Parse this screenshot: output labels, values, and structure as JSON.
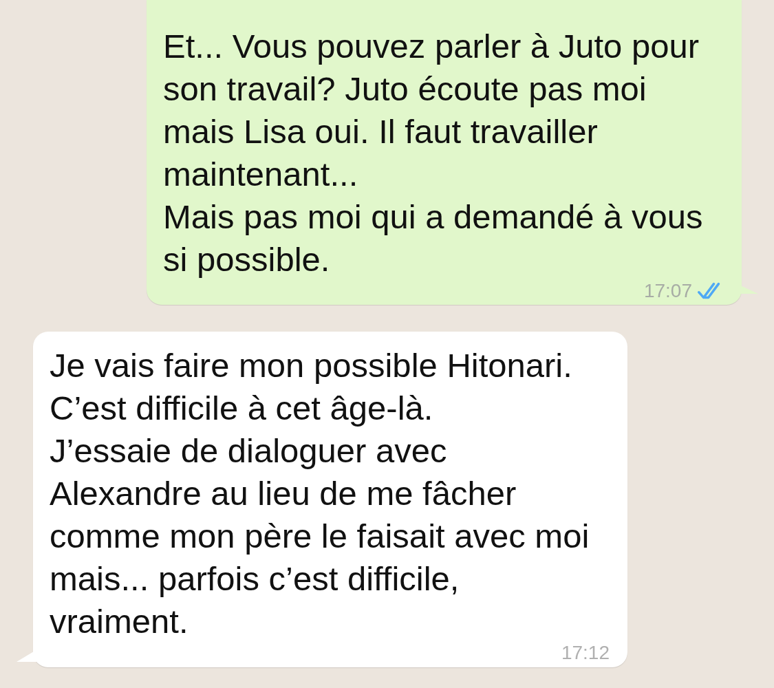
{
  "messages": [
    {
      "kind": "outgoing",
      "text": "Et... Vous pouvez parler à Juto pour\nson travail? Juto écoute pas moi\nmais Lisa oui. Il faut travailler\nmaintenant...\nMais pas moi qui a demandé à vous\nsi possible.",
      "time": "17:07",
      "read": true
    },
    {
      "kind": "incoming",
      "text": "Je vais faire mon possible Hitonari.\nC’est difficile à cet âge-là.\nJ’essaie de dialoguer avec\nAlexandre au lieu de me fâcher\ncomme mon père le faisait avec moi\nmais... parfois c’est difficile,\nvraiment.",
      "time": "17:12"
    }
  ]
}
